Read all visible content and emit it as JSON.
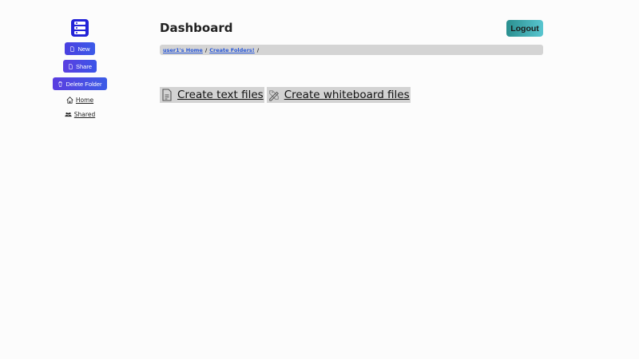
{
  "header": {
    "title": "Dashboard",
    "logout_label": "Logout"
  },
  "sidebar": {
    "new_label": "New",
    "share_label": "Share",
    "delete_label": "Delete Folder",
    "home_label": "Home",
    "shared_label": "Shared"
  },
  "breadcrumb": {
    "items": [
      "user1's Home",
      "Create Folders!"
    ],
    "separator": "/"
  },
  "actions": {
    "text_files": "Create text files",
    "whiteboard_files": "Create whiteboard files"
  },
  "icons": {
    "logo": "server-stack-icon",
    "new": "file-icon",
    "share": "file-icon",
    "delete": "trash-icon",
    "home": "home-icon",
    "shared": "users-icon",
    "text": "document-text-icon",
    "whiteboard": "pencil-ruler-icon"
  },
  "colors": {
    "logo": "#2323d8",
    "primary_button": "#4a48e2",
    "logout_gradient_start": "#2a8f8f",
    "logout_gradient_end": "#59c6d0",
    "breadcrumb_link": "#2857d8",
    "breadcrumb_bg": "#d4d4d4"
  }
}
